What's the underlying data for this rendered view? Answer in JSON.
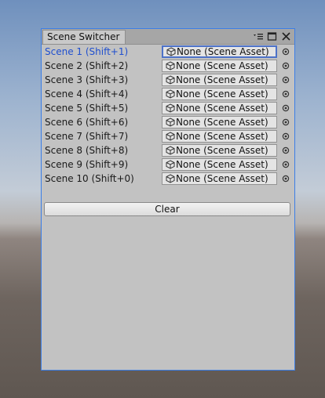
{
  "window": {
    "tab_title": "Scene Switcher"
  },
  "icons": {
    "menu": "menu-icon",
    "maximize": "maximize-icon",
    "close": "close-icon",
    "scene_asset": "unity-scene-icon",
    "object_picker": "object-picker-icon"
  },
  "scenes": [
    {
      "label": "Scene 1 (Shift+1)",
      "value": "None (Scene Asset)"
    },
    {
      "label": "Scene 2 (Shift+2)",
      "value": "None (Scene Asset)"
    },
    {
      "label": "Scene 3 (Shift+3)",
      "value": "None (Scene Asset)"
    },
    {
      "label": "Scene 4 (Shift+4)",
      "value": "None (Scene Asset)"
    },
    {
      "label": "Scene 5 (Shift+5)",
      "value": "None (Scene Asset)"
    },
    {
      "label": "Scene 6 (Shift+6)",
      "value": "None (Scene Asset)"
    },
    {
      "label": "Scene 7 (Shift+7)",
      "value": "None (Scene Asset)"
    },
    {
      "label": "Scene 8 (Shift+8)",
      "value": "None (Scene Asset)"
    },
    {
      "label": "Scene 9 (Shift+9)",
      "value": "None (Scene Asset)"
    },
    {
      "label": "Scene 10 (Shift+0)",
      "value": "None (Scene Asset)"
    }
  ],
  "clear_label": "Clear",
  "colors": {
    "active_label": "#1f4fcf",
    "focus_border": "#4d72c8",
    "window_border": "#3c7ee6"
  }
}
